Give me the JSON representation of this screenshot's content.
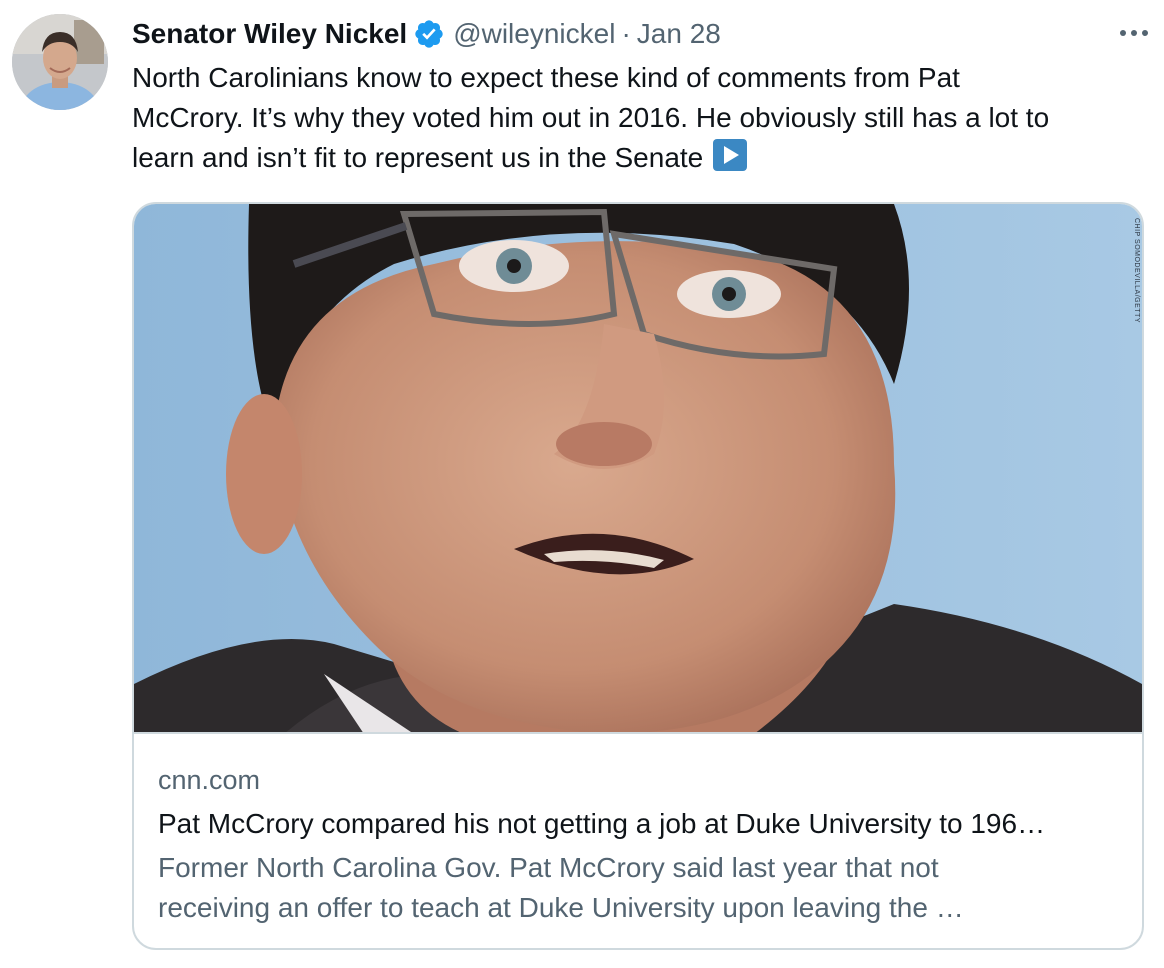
{
  "tweet": {
    "author_name": "Senator Wiley Nickel",
    "handle": "@wileynickel",
    "separator": "·",
    "date": "Jan 28",
    "text_lines": [
      "North Carolinians know to expect these kind of comments from Pat",
      "McCrory. It’s why they voted him out in 2016. He obviously still has a lot to",
      "learn and isn’t fit to represent us in the Senate"
    ],
    "emoji": "play-button-emoji"
  },
  "icons": {
    "verified": "verified-badge-icon",
    "more": "more-options-icon"
  },
  "colors": {
    "verified_blue": "#1d9bf0",
    "secondary_text": "#536471",
    "primary_text": "#0f1419",
    "card_border": "#cfd9de",
    "emoji_blue": "#3b88c3"
  },
  "card": {
    "image_credit": "CHIP SOMODEVILLA/GETTY",
    "domain": "cnn.com",
    "title": "Pat McCrory compared his not getting a job at Duke University to 196…",
    "description_lines": [
      "Former North Carolina Gov. Pat McCrory said last year that not",
      "receiving an offer to teach at Duke University upon leaving the …"
    ]
  }
}
